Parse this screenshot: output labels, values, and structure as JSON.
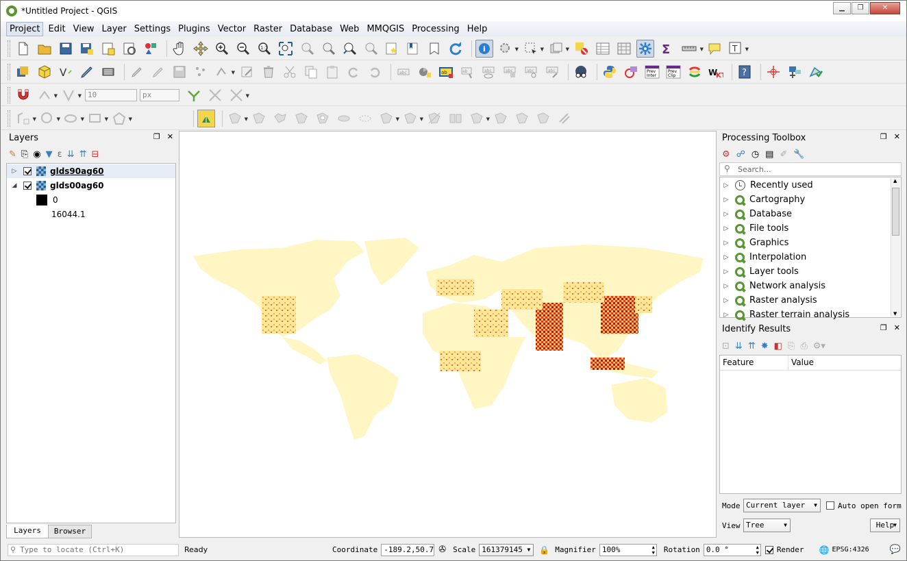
{
  "window": {
    "title": "*Untitled Project - QGIS"
  },
  "menu": [
    "Project",
    "Edit",
    "View",
    "Layer",
    "Settings",
    "Plugins",
    "Vector",
    "Raster",
    "Database",
    "Web",
    "MMQGIS",
    "Processing",
    "Help"
  ],
  "digitizing": {
    "tolerance_value": "10",
    "tolerance_unit": "px"
  },
  "plugin_icons": {
    "prev_inter": "Prev\nInter",
    "prev_clip": "Prev\nClip",
    "wkt": "WKT"
  },
  "layers_panel": {
    "title": "Layers",
    "layers": [
      {
        "name": "glds90ag60",
        "checked": true,
        "expanded": false
      },
      {
        "name": "glds00ag60",
        "checked": true,
        "expanded": true
      }
    ],
    "legend_min": "0",
    "legend_max": "16044.1",
    "tabs": [
      "Layers",
      "Browser"
    ]
  },
  "processing_toolbox": {
    "title": "Processing Toolbox",
    "search_placeholder": "Search…",
    "items": [
      "Recently used",
      "Cartography",
      "Database",
      "File tools",
      "Graphics",
      "Interpolation",
      "Layer tools",
      "Network analysis",
      "Raster analysis",
      "Raster terrain analysis"
    ]
  },
  "identify_results": {
    "title": "Identify Results",
    "columns": [
      "Feature",
      "Value"
    ],
    "mode_label": "Mode",
    "mode_value": "Current layer",
    "auto_open_label": "Auto open form",
    "view_label": "View",
    "view_value": "Tree",
    "help_label": "Help"
  },
  "statusbar": {
    "locate_placeholder": "Type to locate (Ctrl+K)",
    "message": "Ready",
    "coordinate_label": "Coordinate",
    "coordinate_value": "-189.2,50.7",
    "scale_label": "Scale",
    "scale_value": "161379145",
    "magnifier_label": "Magnifier",
    "magnifier_value": "100%",
    "rotation_label": "Rotation",
    "rotation_value": "0.0 °",
    "render_label": "Render",
    "crs": "EPSG:4326"
  },
  "colors": {
    "ramp_low": "#fff5c0",
    "ramp_mid": "#fd8d3c",
    "ramp_high": "#bd0026",
    "accent_green": "#589632"
  }
}
